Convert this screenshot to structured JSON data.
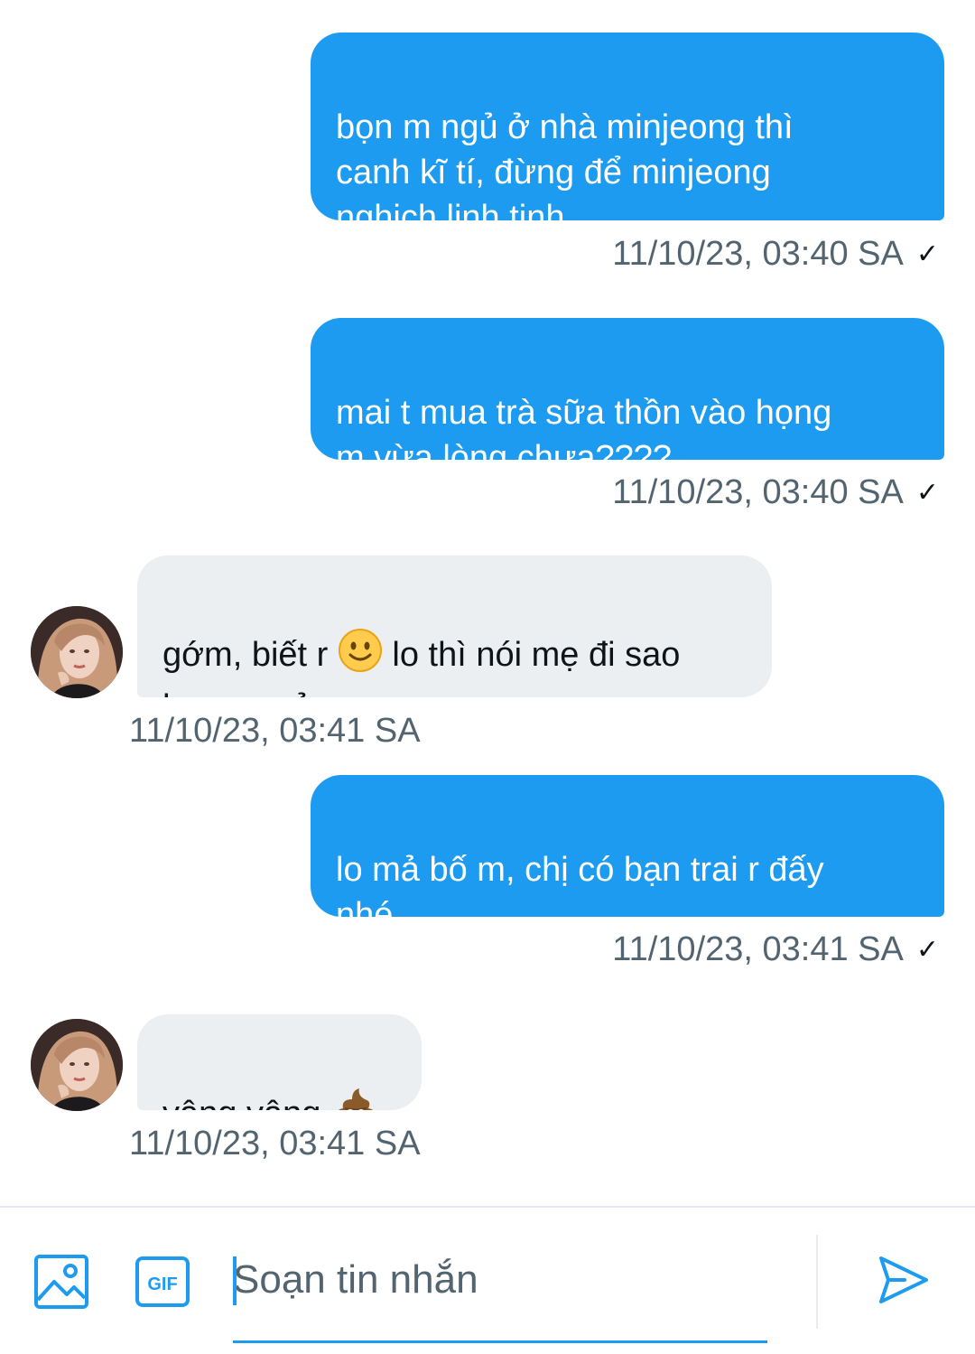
{
  "messages": [
    {
      "direction": "out",
      "text": "bọn m ngủ ở nhà minjeong thì\ncanh kĩ tí, đừng để minjeong\nnghịch linh tinh",
      "time": "11/10/23, 03:40 SA"
    },
    {
      "direction": "out",
      "text": "mai t mua trà sữa thồn vào họng\nm vừa lòng chưa????",
      "time": "11/10/23, 03:40 SA"
    },
    {
      "direction": "in",
      "text_before": "gớm, biết r ",
      "emoji": "slightly-smiling-face",
      "text_after": " lo thì nói mẹ đi sao\nhay ga zẻ wa",
      "time": "11/10/23, 03:41 SA"
    },
    {
      "direction": "out",
      "text": "lo mả bố m, chị có bạn trai r đấy\nnhé",
      "time": "11/10/23, 03:41 SA"
    },
    {
      "direction": "in",
      "text_before": "vâng vâng ",
      "emoji": "pile-of-poo",
      "text_after": "",
      "time": "11/10/23, 03:41 SA"
    }
  ],
  "read_receipt": "✓",
  "composer": {
    "placeholder": "Soạn tin nhắn",
    "image_icon": "image-icon",
    "gif_icon": "gif-icon",
    "gif_label": "GIF",
    "send_icon": "send-icon"
  },
  "colors": {
    "accent": "#1d9bf0",
    "incoming_bubble": "#eceff1",
    "meta_text": "#536471"
  }
}
